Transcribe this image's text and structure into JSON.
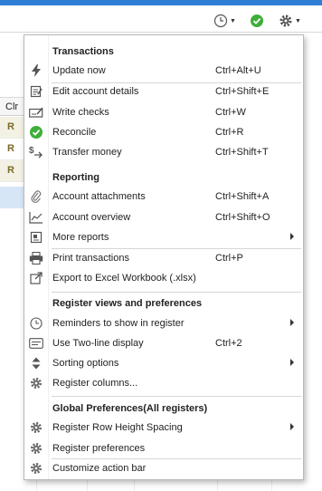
{
  "menu": {
    "sections": {
      "transactions": "Transactions",
      "reporting": "Reporting",
      "register_views": "Register views and preferences",
      "global_prefs": "Global Preferences(All registers)"
    },
    "items": [
      {
        "label": "Update now",
        "shortcut": "Ctrl+Alt+U",
        "icon": "lightning-icon",
        "submenu": false
      },
      {
        "label": "Edit account details",
        "shortcut": "Ctrl+Shift+E",
        "icon": "edit-document-icon",
        "submenu": false
      },
      {
        "label": "Write checks",
        "shortcut": "Ctrl+W",
        "icon": "check-writing-icon",
        "submenu": false
      },
      {
        "label": "Reconcile",
        "shortcut": "Ctrl+R",
        "icon": "reconcile-check-icon",
        "submenu": false
      },
      {
        "label": "Transfer money",
        "shortcut": "Ctrl+Shift+T",
        "icon": "transfer-money-icon",
        "submenu": false
      },
      {
        "label": "Account attachments",
        "shortcut": "Ctrl+Shift+A",
        "icon": "paperclip-icon",
        "submenu": false
      },
      {
        "label": "Account overview",
        "shortcut": "Ctrl+Shift+O",
        "icon": "line-chart-icon",
        "submenu": false
      },
      {
        "label": "More reports",
        "shortcut": "",
        "icon": "report-icon",
        "submenu": true
      },
      {
        "label": "Print transactions",
        "shortcut": "Ctrl+P",
        "icon": "printer-icon",
        "submenu": false
      },
      {
        "label": "Export to Excel Workbook (.xlsx)",
        "shortcut": "",
        "icon": "export-icon",
        "submenu": false
      },
      {
        "label": "Reminders to show in register",
        "shortcut": "",
        "icon": "clock-icon",
        "submenu": true
      },
      {
        "label": "Use Two-line display",
        "shortcut": "Ctrl+2",
        "icon": "two-line-display-icon",
        "submenu": false
      },
      {
        "label": "Sorting options",
        "shortcut": "",
        "icon": "sort-icon",
        "submenu": true
      },
      {
        "label": "Register columns...",
        "shortcut": "",
        "icon": "gear-icon",
        "submenu": false
      },
      {
        "label": "Register Row Height Spacing",
        "shortcut": "",
        "icon": "gear-icon",
        "submenu": true
      },
      {
        "label": "Register preferences",
        "shortcut": "",
        "icon": "gear-icon",
        "submenu": false
      },
      {
        "label": "Customize action bar",
        "shortcut": "",
        "icon": "gear-icon",
        "submenu": false
      }
    ]
  },
  "register": {
    "clr_header": "Clr",
    "clr_values": [
      "R",
      "R",
      "R"
    ]
  },
  "toolbar": {
    "icons": [
      "clock-icon",
      "green-check-icon",
      "gear-icon"
    ]
  },
  "colors": {
    "accent_green": "#3fae3a",
    "selected_row": "#d6e6f7",
    "title_strip": "#2e7fd4"
  }
}
